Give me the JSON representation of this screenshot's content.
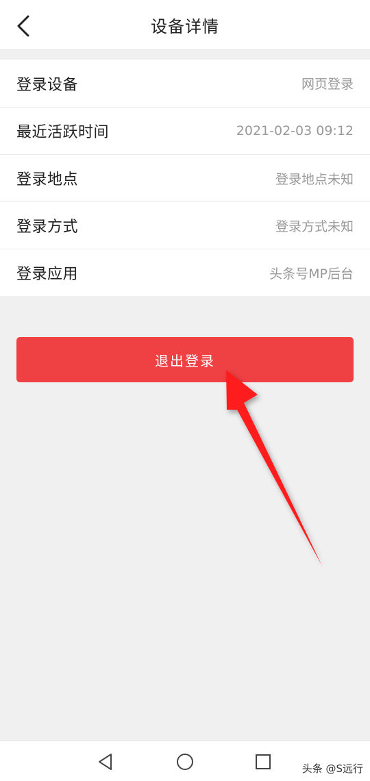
{
  "header": {
    "title": "设备详情",
    "back_icon": "chevron-left-icon"
  },
  "details": {
    "rows": [
      {
        "label": "登录设备",
        "value": "网页登录"
      },
      {
        "label": "最近活跃时间",
        "value": "2021-02-03 09:12"
      },
      {
        "label": "登录地点",
        "value": "登录地点未知"
      },
      {
        "label": "登录方式",
        "value": "登录方式未知"
      },
      {
        "label": "登录应用",
        "value": "头条号MP后台"
      }
    ]
  },
  "logout_button": {
    "label": "退出登录",
    "color": "#ef4044"
  },
  "annotation": {
    "arrow_color": "#ff1e1e"
  },
  "system_nav": {
    "back_icon": "triangle-back-icon",
    "home_icon": "circle-home-icon",
    "recents_icon": "square-recents-icon"
  },
  "watermark": {
    "text": "头条 @S远行"
  }
}
